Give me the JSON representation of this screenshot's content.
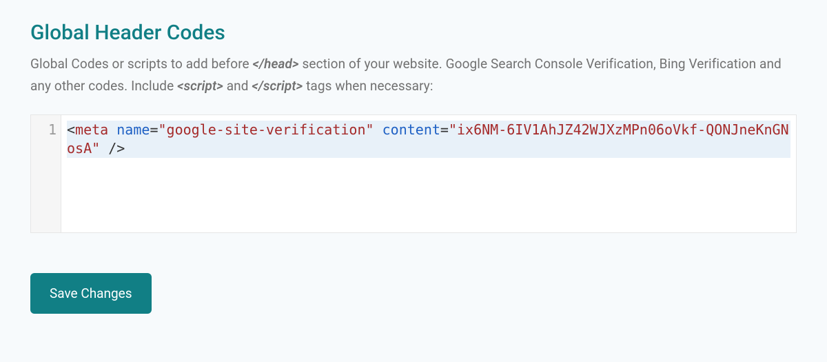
{
  "section": {
    "title": "Global Header Codes",
    "desc_parts": {
      "p1": "Global Codes or scripts to add before ",
      "tag_head": "</head>",
      "p2": " section of your website. Google Search Console Verification, Bing Verification and any other codes. Include ",
      "tag_script_open": "<script>",
      "p3": " and ",
      "tag_script_close": "</script>",
      "p4": " tags when necessary:"
    }
  },
  "editor": {
    "line_number": "1",
    "code": {
      "open_bracket": "<",
      "tag": "meta",
      "sp1": " ",
      "attr1": "name",
      "eq": "=",
      "val1": "\"google-site-verification\"",
      "sp2": " ",
      "attr2": "content",
      "val2": "\"ix6NM-6IV1AhJZ42WJXzMPn06oVkf-QONJneKnGNosA\"",
      "sp3": " ",
      "self_close": "/>"
    }
  },
  "actions": {
    "save_label": "Save Changes"
  }
}
